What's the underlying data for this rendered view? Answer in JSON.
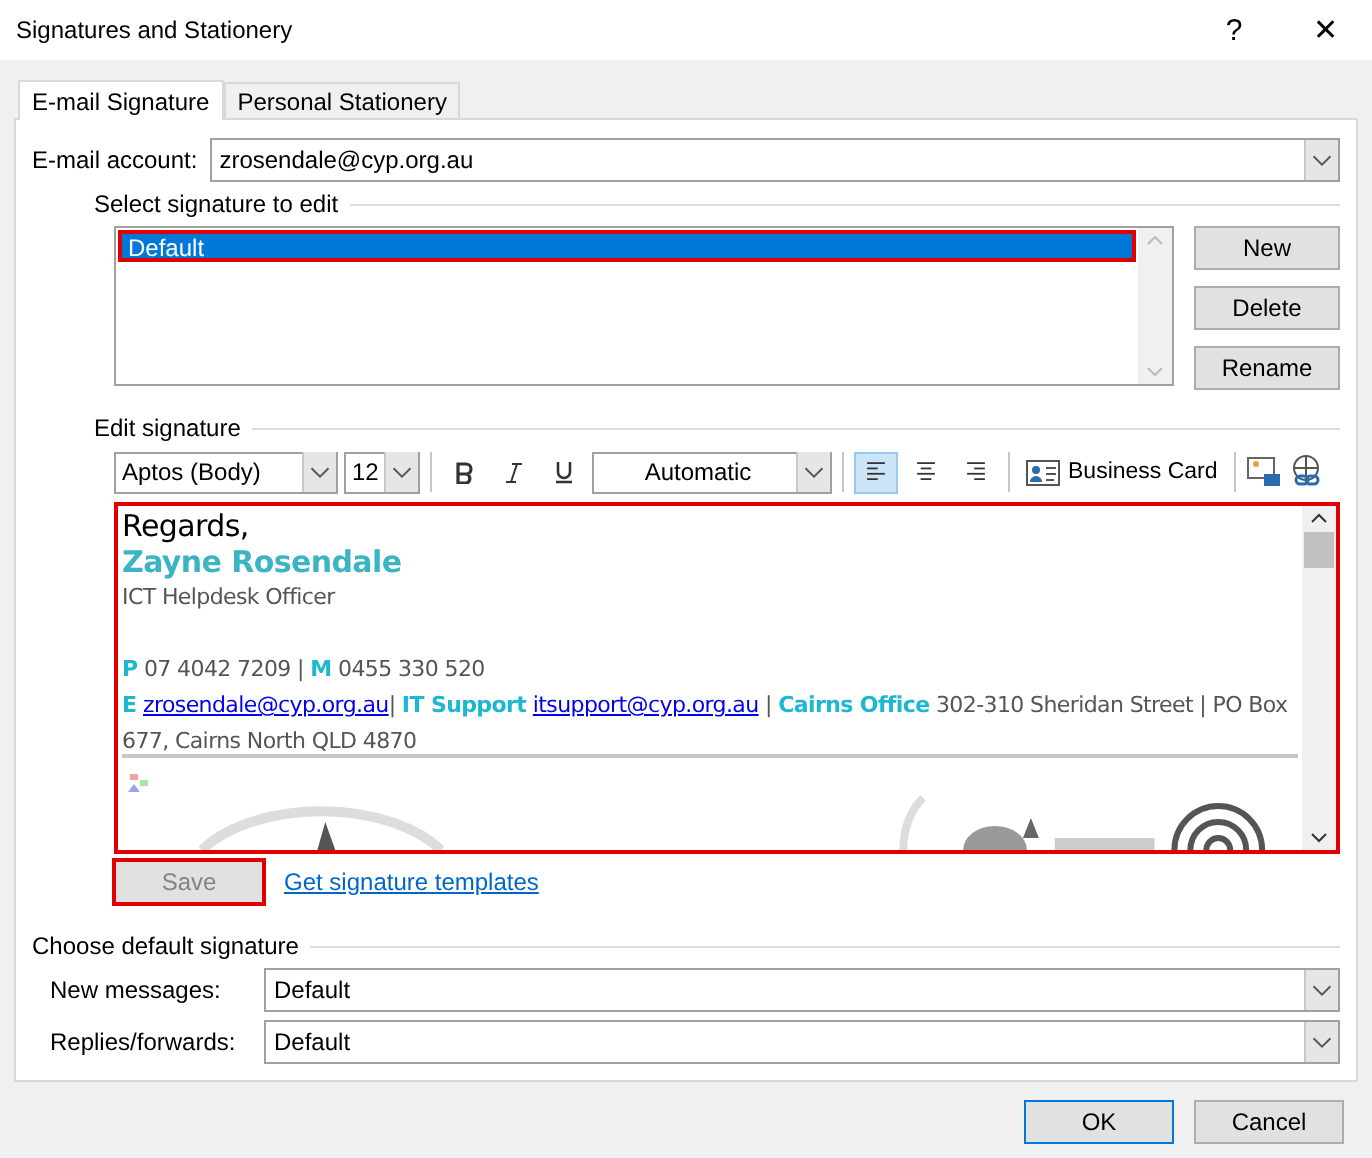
{
  "window": {
    "title": "Signatures and Stationery",
    "help": "?",
    "close": "✕"
  },
  "tabs": [
    {
      "label": "E-mail Signature",
      "selected": true
    },
    {
      "label": "Personal Stationery",
      "selected": false
    }
  ],
  "account": {
    "label": "E-mail account:",
    "value": "zrosendale@cyp.org.au"
  },
  "select_group": {
    "label": "Select signature to edit",
    "items": [
      {
        "label": "Default",
        "selected": true,
        "highlighted": true
      }
    ],
    "buttons": [
      "New",
      "Delete",
      "Rename"
    ]
  },
  "edit_group": {
    "label": "Edit signature"
  },
  "toolbar": {
    "font": "Aptos (Body)",
    "size": "12",
    "font_color_name": "Automatic",
    "business_card": "Business Card",
    "bold": false,
    "italic": false,
    "underline": false,
    "alignment": [
      {
        "kind": "left",
        "selected": true
      },
      {
        "kind": "center",
        "selected": false
      },
      {
        "kind": "right",
        "selected": false
      }
    ]
  },
  "signature": {
    "highlighted": true,
    "paragraphs": [
      {
        "kind": "greeting",
        "segments": [
          {
            "text": "Regards,",
            "kind": "plain"
          }
        ]
      },
      {
        "kind": "name",
        "segments": [
          {
            "text": "Zayne Rosendale",
            "kind": "plain"
          }
        ]
      },
      {
        "kind": "title",
        "segments": [
          {
            "text": "ICT Helpdesk Officer",
            "kind": "plain"
          }
        ]
      },
      {
        "kind": "contact",
        "segments": [
          {
            "text": "P",
            "kind": "accent"
          },
          {
            "text": " 07 4042 7209  | ",
            "kind": "plain"
          },
          {
            "text": "M",
            "kind": "accent"
          },
          {
            "text": " 0455 330 520",
            "kind": "plain"
          }
        ]
      },
      {
        "kind": "contact",
        "segments": [
          {
            "text": "E",
            "kind": "accent"
          },
          {
            "text": "zrosendale@cyp.org.au",
            "kind": "link"
          },
          {
            "text": "| ",
            "kind": "plain"
          },
          {
            "text": "IT Support",
            "kind": "accent"
          },
          {
            "text": "itsupport@cyp.org.au",
            "kind": "link"
          },
          {
            "text": " | ",
            "kind": "plain"
          },
          {
            "text": "Cairns Office",
            "kind": "accent"
          },
          {
            "text": " 302-310 Sheridan Street | PO Box 677, Cairns North QLD 4870",
            "kind": "plain"
          }
        ]
      }
    ]
  },
  "save": {
    "label": "Save",
    "disabled": true,
    "highlighted": true
  },
  "templates_link": "Get signature templates",
  "default_group": {
    "label": "Choose default signature",
    "rows": [
      {
        "label": "New messages:",
        "value": "Default"
      },
      {
        "label": "Replies/forwards:",
        "value": "Default"
      }
    ]
  },
  "footer": {
    "ok": "OK",
    "cancel": "Cancel"
  }
}
